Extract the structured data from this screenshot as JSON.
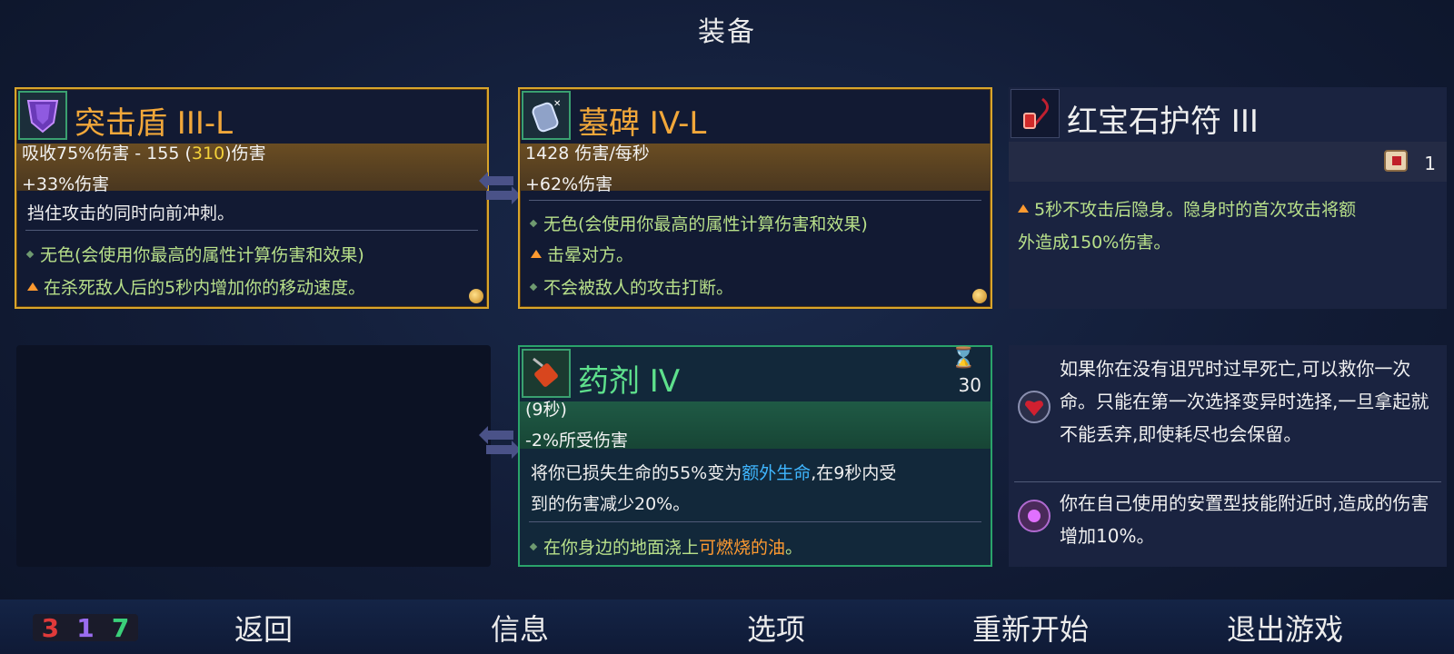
{
  "page_title": "装备",
  "cards": {
    "shield": {
      "title": "突击盾 III-L",
      "stat1_pre": "吸收75%伤害 - 155 (",
      "stat1_hl": "310",
      "stat1_post": ")伤害",
      "stat2": "+33%伤害",
      "desc": "挡住攻击的同时向前冲刺。",
      "trait1": "无色(会使用你最高的属性计算伤害和效果)",
      "trait2": "在杀死敌人后的5秒内增加你的移动速度。"
    },
    "tomb": {
      "title": "墓碑 IV-L",
      "stat1": "1428 伤害/每秒",
      "stat2": "+62%伤害",
      "trait1": "无色(会使用你最高的属性计算伤害和效果)",
      "trait2": "击晕对方。",
      "trait3": "不会被敌人的攻击打断。"
    },
    "amulet": {
      "title": "红宝石护符 III",
      "scroll_count": "1",
      "desc_line1": "5秒不攻击后隐身。隐身时的首次攻击将额",
      "desc_line2": "外造成150%伤害。"
    },
    "potion": {
      "title": "药剂 IV",
      "cooldown": "30",
      "stat1": "(9秒)",
      "stat2": "-2%所受伤害",
      "desc1_pre": "将你已损失生命的55%变为",
      "desc1_hl": "额外生命",
      "desc1_post": ",在9秒内受",
      "desc2": "到的伤害减少20%。",
      "trait_pre": "在你身边的地面浇上",
      "trait_hl": "可燃烧的油",
      "trait_post": "。"
    },
    "mutations": {
      "m1": "如果你在没有诅咒时过早死亡,可以救你一次命。只能在第一次选择变异时选择,一旦拿起就不能丢弃,即使耗尽也会保留。",
      "m2": "你在自己使用的安置型技能附近时,造成的伤害增加10%。"
    }
  },
  "stats": {
    "red": "3",
    "purple": "1",
    "green": "7"
  },
  "nav": {
    "back": "返回",
    "info": "信息",
    "options": "选项",
    "restart": "重新开始",
    "quit": "退出游戏"
  },
  "colors": {
    "gold_border": "#d9a52b",
    "green_border": "#2aa36a",
    "stat_red": "#e03a3a",
    "stat_purple": "#9a6cf0",
    "stat_green": "#3ad07a"
  }
}
